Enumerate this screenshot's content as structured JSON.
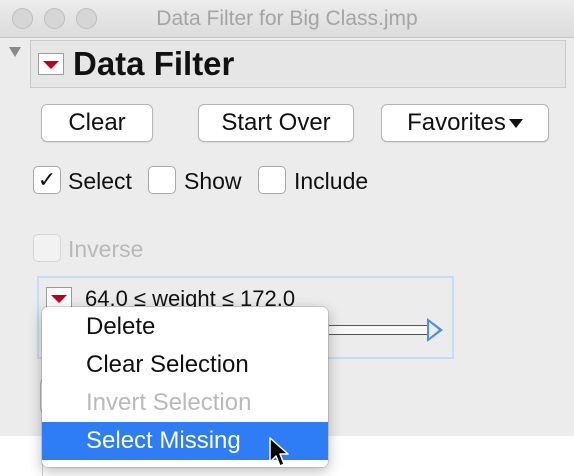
{
  "window": {
    "title": "Data Filter for Big Class.jmp"
  },
  "header": {
    "title": "Data Filter"
  },
  "buttons": {
    "clear": "Clear",
    "start_over": "Start Over",
    "favorites": "Favorites"
  },
  "options": {
    "select": "Select",
    "show": "Show",
    "include": "Include",
    "inverse": "Inverse",
    "check_mark": "✓"
  },
  "filter": {
    "label": "64.0 ≤ weight ≤ 172.0"
  },
  "context_menu": {
    "items": [
      {
        "label": "Delete",
        "enabled": true,
        "highlighted": false
      },
      {
        "label": "Clear Selection",
        "enabled": true,
        "highlighted": false
      },
      {
        "label": "Invert Selection",
        "enabled": false,
        "highlighted": false
      },
      {
        "label": "Select Missing",
        "enabled": true,
        "highlighted": true
      }
    ]
  },
  "colors": {
    "accent": "#2e7cf6",
    "red_triangle": "#c0001b",
    "focus": "#c4dcf6"
  }
}
